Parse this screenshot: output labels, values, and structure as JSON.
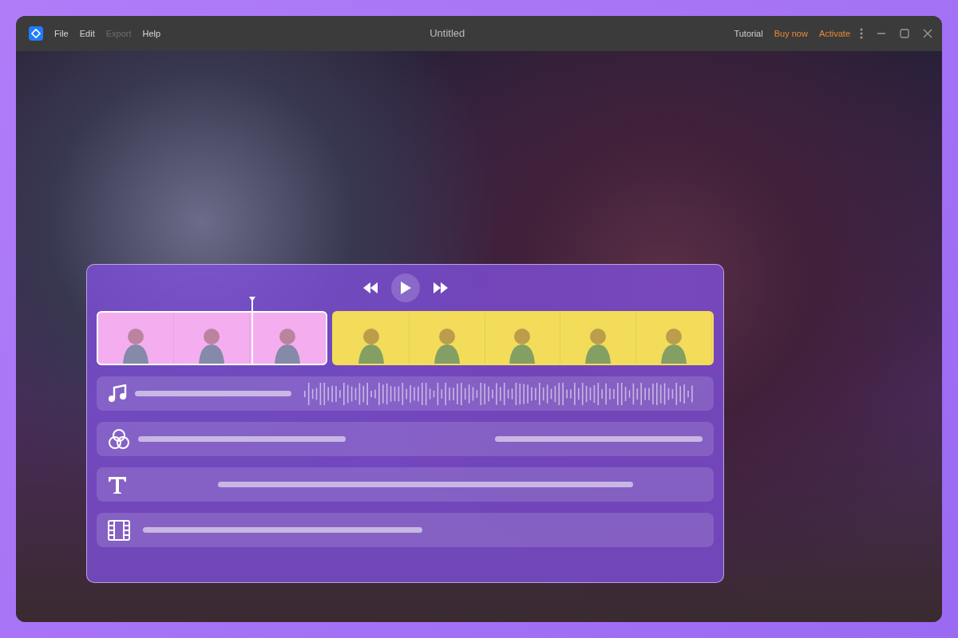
{
  "window": {
    "title": "Untitled"
  },
  "menu": [
    {
      "label": "File",
      "disabled": false
    },
    {
      "label": "Edit",
      "disabled": false
    },
    {
      "label": "Export",
      "disabled": true
    },
    {
      "label": "Help",
      "disabled": false
    }
  ],
  "header_links": [
    {
      "label": "Tutorial",
      "kind": "plain"
    },
    {
      "label": "Buy now",
      "kind": "accent"
    },
    {
      "label": "Activate",
      "kind": "accent"
    }
  ],
  "clips": [
    {
      "color": "#f4aef0",
      "selected": true
    },
    {
      "color": "#f2dc5a",
      "selected": false
    }
  ],
  "tracks": [
    {
      "kind": "audio"
    },
    {
      "kind": "effects"
    },
    {
      "kind": "text"
    },
    {
      "kind": "video"
    }
  ]
}
